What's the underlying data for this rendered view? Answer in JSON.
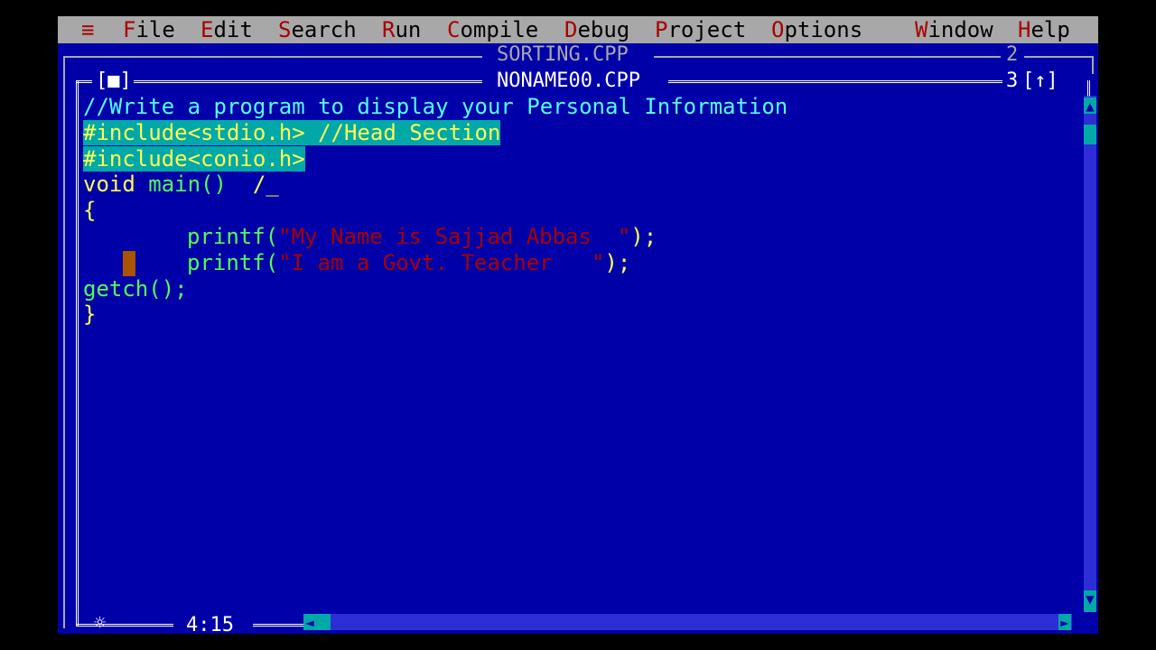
{
  "menu": {
    "system": "≡",
    "items": [
      {
        "hot": "F",
        "rest": "ile"
      },
      {
        "hot": "E",
        "rest": "dit"
      },
      {
        "hot": "S",
        "rest": "earch"
      },
      {
        "hot": "R",
        "rest": "un"
      },
      {
        "hot": "C",
        "rest": "ompile"
      },
      {
        "hot": "D",
        "rest": "ebug"
      },
      {
        "hot": "P",
        "rest": "roject"
      },
      {
        "hot": "O",
        "rest": "ptions"
      },
      {
        "hot": "W",
        "rest": "indow"
      },
      {
        "hot": "H",
        "rest": "elp"
      }
    ]
  },
  "back_window": {
    "title": "SORTING.CPP",
    "number": "2"
  },
  "editor": {
    "title": "NONAME00.CPP",
    "number": "3",
    "close_box": "[■]",
    "zoom_box": "[↑]",
    "position": "4:15",
    "modified_marker": "☼",
    "lines": {
      "comment": "//Write a program to display your Personal Information",
      "include1": "#include<stdio.h> //Head Section",
      "include2": "#include<conio.h>",
      "main_void": "void ",
      "main_fn": "main()",
      "main_tail": "  /_",
      "open_brace": "{",
      "p1_fn": "printf(",
      "p1_str": "\"My Name is Sajjad Abbas  \"",
      "p1_end": ");",
      "p2_fn": "printf(",
      "p2_str": "\"I am a Govt. Teacher   \"",
      "p2_end": ");",
      "getch": "getch();",
      "close_brace": "}"
    }
  },
  "colors": {
    "background": "#0000a8",
    "menubar": "#a8a8a8",
    "hotkey": "#a80000",
    "code": "#ffff54",
    "comment": "#54fcfc",
    "function": "#54fc54",
    "string": "#a80000"
  }
}
